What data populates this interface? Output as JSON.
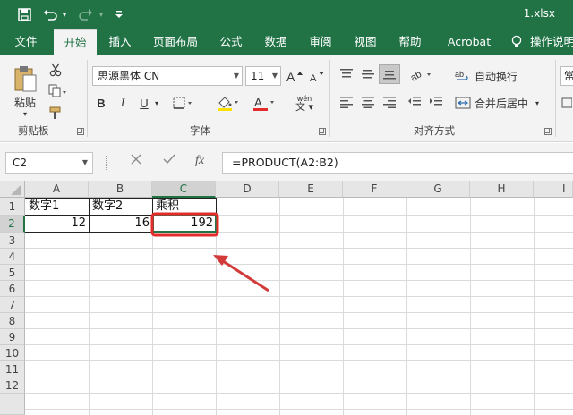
{
  "titlebar": {
    "filename": "1.xlsx"
  },
  "tabs": [
    "文件",
    "开始",
    "插入",
    "页面布局",
    "公式",
    "数据",
    "审阅",
    "视图",
    "帮助",
    "Acrobat",
    "操作说明"
  ],
  "ribbon": {
    "clipboard": {
      "paste_label": "粘贴",
      "group_label": "剪贴板"
    },
    "font": {
      "family": "思源黑体 CN",
      "size": "11",
      "bold": "B",
      "italic": "I",
      "underline": "U",
      "phonetic": "wén",
      "group_label": "字体"
    },
    "alignment": {
      "wrap_label": "自动换行",
      "merge_label": "合并后居中",
      "group_label": "对齐方式"
    },
    "number_format_partial": "常"
  },
  "formula_bar": {
    "name_box": "C2",
    "fx": "fx",
    "formula": "=PRODUCT(A2:B2)"
  },
  "columns": [
    "A",
    "B",
    "C",
    "D",
    "E",
    "F",
    "G",
    "H",
    "I"
  ],
  "rows": [
    "1",
    "2",
    "3",
    "4",
    "5",
    "6",
    "7",
    "8",
    "9",
    "10",
    "11",
    "12"
  ],
  "cells": {
    "A1": "数字1",
    "B1": "数字2",
    "C1": "乘积",
    "A2": "12",
    "B2": "16",
    "C2": "192"
  },
  "colors": {
    "accent": "#217346",
    "highlight": "#e32b2b"
  }
}
